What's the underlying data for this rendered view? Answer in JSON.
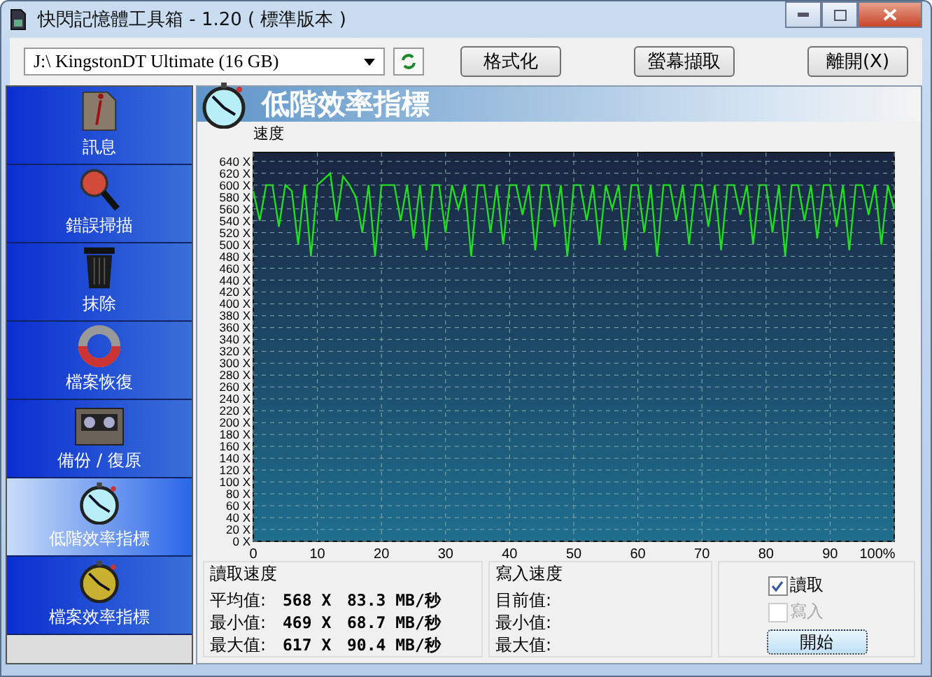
{
  "window": {
    "title": "快閃記憶體工具箱 - 1.20 ( 標準版本 )"
  },
  "toolbar": {
    "device": "J:\\ KingstonDT Ultimate (16 GB)",
    "buttons": [
      "格式化",
      "螢幕擷取",
      "離開(X)"
    ]
  },
  "sidebar": {
    "items": [
      {
        "label": "訊息",
        "selected": false
      },
      {
        "label": "錯誤掃描",
        "selected": false
      },
      {
        "label": "抹除",
        "selected": false
      },
      {
        "label": "檔案恢復",
        "selected": false
      },
      {
        "label": "備份 / 復原",
        "selected": false
      },
      {
        "label": "低階效率指標",
        "selected": true
      },
      {
        "label": "檔案效率指標",
        "selected": false
      }
    ]
  },
  "panel": {
    "title": "低階效率指標",
    "chart_data": {
      "type": "line",
      "ylabel": "速度",
      "grid": true,
      "xlim": [
        0,
        100
      ],
      "ylim": [
        0,
        655
      ],
      "x": [
        0,
        1,
        2,
        3,
        4,
        5,
        6,
        7,
        8,
        9,
        10,
        11,
        12,
        13,
        14,
        15,
        16,
        17,
        18,
        19,
        20,
        21,
        22,
        23,
        24,
        25,
        26,
        27,
        28,
        29,
        30,
        31,
        32,
        33,
        34,
        35,
        36,
        37,
        38,
        39,
        40,
        41,
        42,
        43,
        44,
        45,
        46,
        47,
        48,
        49,
        50,
        51,
        52,
        53,
        54,
        55,
        56,
        57,
        58,
        59,
        60,
        61,
        62,
        63,
        64,
        65,
        66,
        67,
        68,
        69,
        70,
        71,
        72,
        73,
        74,
        75,
        76,
        77,
        78,
        79,
        80,
        81,
        82,
        83,
        84,
        85,
        86,
        87,
        88,
        89,
        90,
        91,
        92,
        93,
        94,
        95,
        96,
        97,
        98,
        99,
        100
      ],
      "xticks": [
        0,
        10,
        20,
        30,
        40,
        50,
        60,
        70,
        80,
        90,
        {
          "value": 100,
          "label": "100%"
        }
      ],
      "yticks": [
        {
          "value": 0,
          "label": "0 X"
        },
        {
          "value": 20,
          "label": "20 X"
        },
        {
          "value": 40,
          "label": "40 X"
        },
        {
          "value": 60,
          "label": "60 X"
        },
        {
          "value": 80,
          "label": "80 X"
        },
        {
          "value": 100,
          "label": "100 X"
        },
        {
          "value": 120,
          "label": "120 X"
        },
        {
          "value": 140,
          "label": "140 X"
        },
        {
          "value": 160,
          "label": "160 X"
        },
        {
          "value": 180,
          "label": "180 X"
        },
        {
          "value": 200,
          "label": "200 X"
        },
        {
          "value": 220,
          "label": "220 X"
        },
        {
          "value": 240,
          "label": "240 X"
        },
        {
          "value": 260,
          "label": "260 X"
        },
        {
          "value": 280,
          "label": "280 X"
        },
        {
          "value": 300,
          "label": "300 X"
        },
        {
          "value": 320,
          "label": "320 X"
        },
        {
          "value": 340,
          "label": "340 X"
        },
        {
          "value": 360,
          "label": "360 X"
        },
        {
          "value": 380,
          "label": "380 X"
        },
        {
          "value": 400,
          "label": "400 X"
        },
        {
          "value": 420,
          "label": "420 X"
        },
        {
          "value": 440,
          "label": "440 X"
        },
        {
          "value": 460,
          "label": "460 X"
        },
        {
          "value": 480,
          "label": "480 X"
        },
        {
          "value": 500,
          "label": "500 X"
        },
        {
          "value": 520,
          "label": "520 X"
        },
        {
          "value": 540,
          "label": "540 X"
        },
        {
          "value": 560,
          "label": "560 X"
        },
        {
          "value": 580,
          "label": "580 X"
        },
        {
          "value": 600,
          "label": "600 X"
        },
        {
          "value": 620,
          "label": "620 X"
        },
        {
          "value": 640,
          "label": "640 X"
        }
      ],
      "series": [
        {
          "color": "#22dd22",
          "values": [
            590,
            540,
            600,
            600,
            530,
            600,
            590,
            500,
            600,
            480,
            600,
            610,
            620,
            540,
            615,
            600,
            580,
            520,
            600,
            480,
            600,
            600,
            600,
            540,
            600,
            510,
            600,
            490,
            600,
            600,
            520,
            600,
            560,
            600,
            480,
            600,
            600,
            520,
            600,
            500,
            600,
            600,
            550,
            600,
            490,
            600,
            600,
            530,
            600,
            480,
            600,
            600,
            540,
            600,
            500,
            600,
            560,
            600,
            490,
            600,
            600,
            520,
            600,
            480,
            600,
            600,
            540,
            600,
            500,
            600,
            600,
            530,
            600,
            490,
            600,
            600,
            550,
            600,
            500,
            600,
            600,
            520,
            600,
            480,
            600,
            600,
            540,
            600,
            510,
            600,
            600,
            530,
            600,
            490,
            600,
            600,
            550,
            600,
            500,
            600,
            560
          ]
        }
      ]
    }
  },
  "read_speed": {
    "title": "讀取速度",
    "rows": [
      {
        "label": "平均值:",
        "ratio": "568 X",
        "speed": "83.3 MB/秒"
      },
      {
        "label": "最小值:",
        "ratio": "469 X",
        "speed": "68.7 MB/秒"
      },
      {
        "label": "最大值:",
        "ratio": "617 X",
        "speed": "90.4 MB/秒"
      }
    ]
  },
  "write_speed": {
    "title": "寫入速度",
    "rows": [
      {
        "label": "目前值:"
      },
      {
        "label": "最小值:"
      },
      {
        "label": "最大值:"
      }
    ]
  },
  "options": [
    {
      "label": "讀取",
      "checked": true,
      "disabled": false
    },
    {
      "label": "寫入",
      "checked": false,
      "disabled": true
    }
  ],
  "start_button": "開始"
}
